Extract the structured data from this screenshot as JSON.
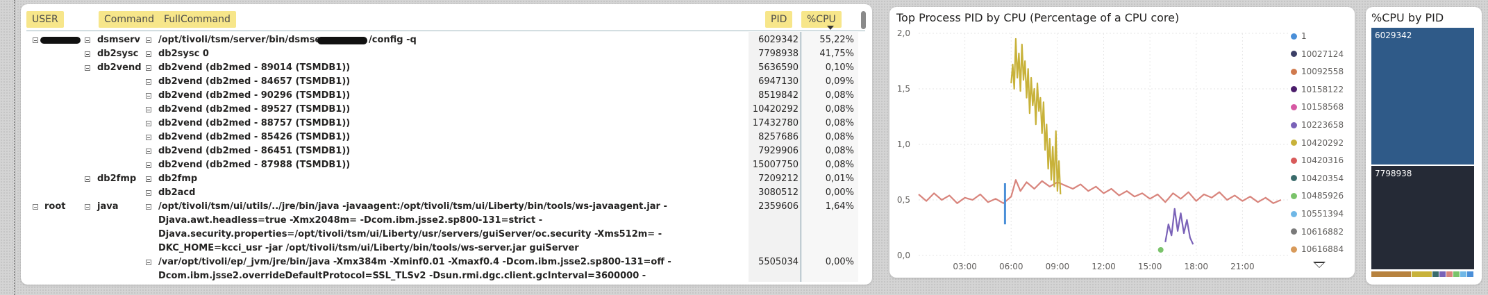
{
  "table": {
    "headers": {
      "user": "USER",
      "command": "Command",
      "full_command": "FullCommand",
      "pid": "PID",
      "cpu": "%CPU"
    },
    "groups": [
      {
        "user": "",
        "command": "dsmserv",
        "full_command": "/opt/tivoli/tsm/server/bin/dsmserv -",
        "full_command_suffix": "/config -q",
        "pid": "6029342",
        "cpu": "55,22%"
      },
      {
        "command": "db2sysc",
        "full_command": "db2sysc 0",
        "pid": "7798938",
        "cpu": "41,75%"
      },
      {
        "command": "db2vend",
        "full_command": "db2vend (db2med - 89014 (TSMDB1))",
        "pid": "5636590",
        "cpu": "0,10%"
      },
      {
        "full_command": "db2vend (db2med - 84657 (TSMDB1))",
        "pid": "6947130",
        "cpu": "0,09%"
      },
      {
        "full_command": "db2vend (db2med - 90296 (TSMDB1))",
        "pid": "8519842",
        "cpu": "0,08%"
      },
      {
        "full_command": "db2vend (db2med - 89527 (TSMDB1))",
        "pid": "10420292",
        "cpu": "0,08%"
      },
      {
        "full_command": "db2vend (db2med - 88757 (TSMDB1))",
        "pid": "17432780",
        "cpu": "0,08%"
      },
      {
        "full_command": "db2vend (db2med - 85426 (TSMDB1))",
        "pid": "8257686",
        "cpu": "0,08%"
      },
      {
        "full_command": "db2vend (db2med - 86451 (TSMDB1))",
        "pid": "7929906",
        "cpu": "0,08%"
      },
      {
        "full_command": "db2vend (db2med - 87988 (TSMDB1))",
        "pid": "15007750",
        "cpu": "0,08%"
      },
      {
        "command": "db2fmp",
        "full_command": "db2fmp",
        "pid": "7209212",
        "cpu": "0,01%"
      },
      {
        "full_command": "db2acd",
        "pid": "3080512",
        "cpu": "0,00%"
      },
      {
        "user": "root",
        "command": "java",
        "full_command": "/opt/tivoli/tsm/ui/utils/../jre/bin/java -javaagent:/opt/tivoli/tsm/ui/Liberty/bin/tools/ws-javaagent.jar -Djava.awt.headless=true -Xmx2048m= -Dcom.ibm.jsse2.sp800-131=strict -Djava.security.properties=/opt/tivoli/tsm/ui/Liberty/usr/servers/guiServer/oc.security -Xms512m= -DKC_HOME=kcci_usr -jar /opt/tivoli/tsm/ui/Liberty/bin/tools/ws-server.jar guiServer",
        "pid": "2359606",
        "cpu": "1,64%"
      },
      {
        "full_command": "/var/opt/tivoli/ep/_jvm/jre/bin/java -Xmx384m -Xminf0.01 -Xmaxf0.4 -Dcom.ibm.jsse2.sp800-131=off -Dcom.ibm.jsse2.overrideDefaultProtocol=SSL_TLSv2 -Dsun.rmi.dgc.client.gcInterval=3600000 -",
        "pid": "5505034",
        "cpu": "0,00%"
      }
    ]
  },
  "line_chart": {
    "title": "Top Process PID by CPU (Percentage of a CPU core)",
    "legend": [
      {
        "label": "1",
        "color": "#4a8fd8"
      },
      {
        "label": "10027124",
        "color": "#3b3f66"
      },
      {
        "label": "10092558",
        "color": "#d07a4e"
      },
      {
        "label": "10158122",
        "color": "#4b1d6b"
      },
      {
        "label": "10158568",
        "color": "#d659a3"
      },
      {
        "label": "10223658",
        "color": "#7a62b8"
      },
      {
        "label": "10420292",
        "color": "#c8b23a"
      },
      {
        "label": "10420316",
        "color": "#d85a5a"
      },
      {
        "label": "10420354",
        "color": "#3a6b6b"
      },
      {
        "label": "10485926",
        "color": "#7ac36a"
      },
      {
        "label": "10551394",
        "color": "#6fb7e6"
      },
      {
        "label": "10616882",
        "color": "#7a7a7a"
      },
      {
        "label": "10616884",
        "color": "#d89a5a"
      }
    ]
  },
  "chart_data": {
    "type": "line",
    "title": "Top Process PID by CPU (Percentage of a CPU core)",
    "xlabel": "",
    "ylabel": "",
    "x_ticks": [
      "03:00",
      "06:00",
      "09:00",
      "12:00",
      "15:00",
      "18:00",
      "21:00"
    ],
    "y_ticks": [
      "0,0",
      "0,5",
      "1,0",
      "1,5",
      "2,0"
    ],
    "xlim": [
      0,
      24
    ],
    "ylim": [
      0,
      2
    ],
    "grid": true,
    "legend_position": "right",
    "series": [
      {
        "name": "10420316",
        "color": "#d8847c",
        "x": [
          0.0,
          0.5,
          1.0,
          1.5,
          2.0,
          2.5,
          3.0,
          3.5,
          4.0,
          4.5,
          5.0,
          5.5,
          6.0,
          6.3,
          6.6,
          7.0,
          7.5,
          8.0,
          8.5,
          9.0,
          9.5,
          10.0,
          10.5,
          11.0,
          11.5,
          12.0,
          12.5,
          13.0,
          13.5,
          14.0,
          14.5,
          15.0,
          15.5,
          16.0,
          16.5,
          17.0,
          17.5,
          18.0,
          18.5,
          19.0,
          19.5,
          20.0,
          20.5,
          21.0,
          21.5,
          22.0,
          22.5,
          23.0,
          23.5
        ],
        "y": [
          0.55,
          0.49,
          0.56,
          0.5,
          0.54,
          0.47,
          0.52,
          0.5,
          0.55,
          0.48,
          0.51,
          0.47,
          0.53,
          0.68,
          0.58,
          0.66,
          0.6,
          0.67,
          0.62,
          0.66,
          0.63,
          0.6,
          0.64,
          0.58,
          0.62,
          0.56,
          0.6,
          0.54,
          0.58,
          0.53,
          0.56,
          0.51,
          0.55,
          0.48,
          0.56,
          0.51,
          0.57,
          0.49,
          0.55,
          0.52,
          0.57,
          0.5,
          0.54,
          0.49,
          0.53,
          0.48,
          0.52,
          0.47,
          0.5
        ]
      },
      {
        "name": "10420292",
        "color": "#c8b23a",
        "x": [
          6.0,
          6.1,
          6.2,
          6.3,
          6.4,
          6.5,
          6.6,
          6.7,
          6.8,
          6.9,
          7.0,
          7.1,
          7.2,
          7.3,
          7.4,
          7.5,
          7.6,
          7.7,
          7.8,
          7.9,
          8.0,
          8.1,
          8.2,
          8.3,
          8.4,
          8.5,
          8.6,
          8.7,
          8.8,
          8.9,
          9.0,
          9.1,
          9.2
        ],
        "y": [
          1.55,
          1.72,
          1.5,
          1.95,
          1.6,
          1.82,
          1.48,
          1.9,
          1.58,
          1.75,
          1.42,
          1.68,
          1.28,
          1.6,
          1.35,
          1.5,
          1.18,
          1.55,
          1.3,
          1.42,
          1.1,
          1.38,
          0.95,
          1.18,
          0.78,
          1.05,
          0.68,
          0.98,
          0.62,
          1.12,
          0.58,
          0.85,
          0.55
        ]
      },
      {
        "name": "1",
        "color": "#4a8fd8",
        "x": [
          5.6,
          5.6
        ],
        "y": [
          0.28,
          0.65
        ]
      },
      {
        "name": "10223658",
        "color": "#7a62b8",
        "x": [
          16.0,
          16.2,
          16.4,
          16.6,
          16.8,
          17.0,
          17.2,
          17.4,
          17.6,
          17.8
        ],
        "y": [
          0.12,
          0.28,
          0.18,
          0.42,
          0.22,
          0.38,
          0.2,
          0.32,
          0.16,
          0.1
        ]
      },
      {
        "name": "10485926",
        "color": "#7ac36a",
        "x": [
          15.7,
          15.8
        ],
        "y": [
          0.05,
          0.07
        ]
      }
    ]
  },
  "treemap": {
    "title": "%CPU by PID",
    "tiles": [
      {
        "label": "6029342",
        "value": 55.22,
        "color": "#2f5a88"
      },
      {
        "label": "7798938",
        "value": 41.75,
        "color": "#252a36"
      }
    ],
    "footer_colors": [
      "#b7823e",
      "#c8b23a",
      "#3a6b6b",
      "#7a62b8",
      "#d8847c",
      "#7ac36a",
      "#6fb7e6",
      "#4a8fd8"
    ]
  }
}
